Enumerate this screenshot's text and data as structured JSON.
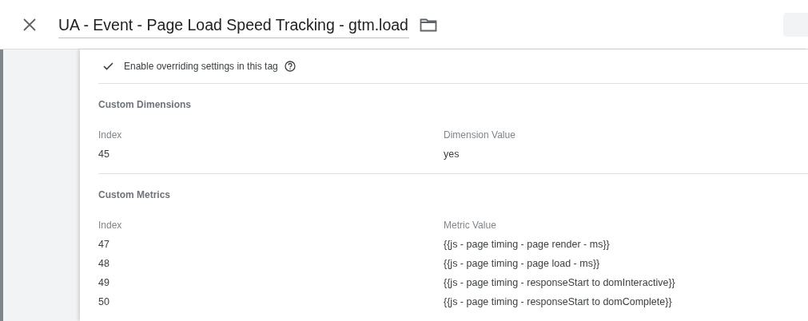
{
  "header": {
    "title": "UA - Event - Page Load Speed Tracking - gtm.load"
  },
  "override": {
    "label": "Enable overriding settings in this tag",
    "checked": true
  },
  "sections": [
    {
      "title": "Custom Dimensions",
      "columns": [
        "Index",
        "Dimension Value"
      ],
      "rows": [
        [
          "45",
          "yes"
        ]
      ]
    },
    {
      "title": "Custom Metrics",
      "columns": [
        "Index",
        "Metric Value"
      ],
      "rows": [
        [
          "47",
          "{{js - page timing - page render - ms}}"
        ],
        [
          "48",
          "{{js - page timing - page load - ms}}"
        ],
        [
          "49",
          "{{js - page timing - responseStart to domInteractive}}"
        ],
        [
          "50",
          "{{js - page timing - responseStart to domComplete}}"
        ]
      ]
    }
  ]
}
